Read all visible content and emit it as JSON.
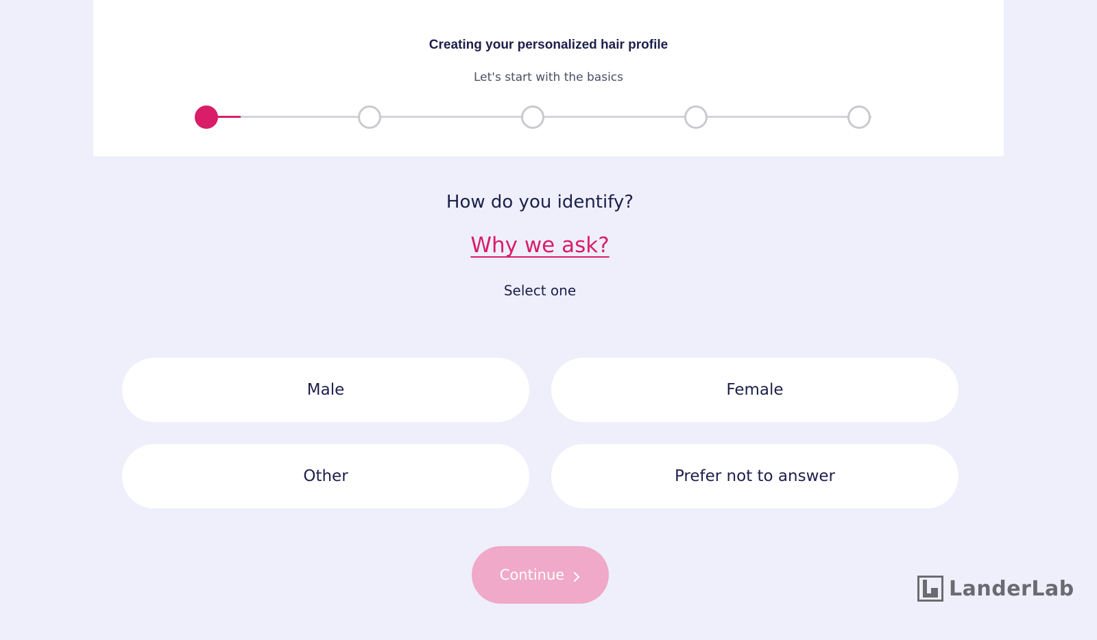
{
  "header": {
    "title": "Creating your personalized hair profile",
    "subtitle": "Let's start with the basics",
    "progress": {
      "total_steps": 5,
      "current_step": 1
    }
  },
  "question": {
    "title": "How do you identify?",
    "why_link": "Why we ask?",
    "hint": "Select one"
  },
  "options": [
    {
      "label": "Male"
    },
    {
      "label": "Female"
    },
    {
      "label": "Other"
    },
    {
      "label": "Prefer not to answer"
    }
  ],
  "continue": {
    "label": "Continue",
    "icon": "chevron-right-icon"
  },
  "brand": {
    "name": "LanderLab",
    "icon": "landerlab-logo-icon"
  },
  "colors": {
    "accent": "#d91d69",
    "accent_disabled": "#f0a9c8",
    "background": "#eeeffa",
    "text": "#1c1f4a"
  }
}
